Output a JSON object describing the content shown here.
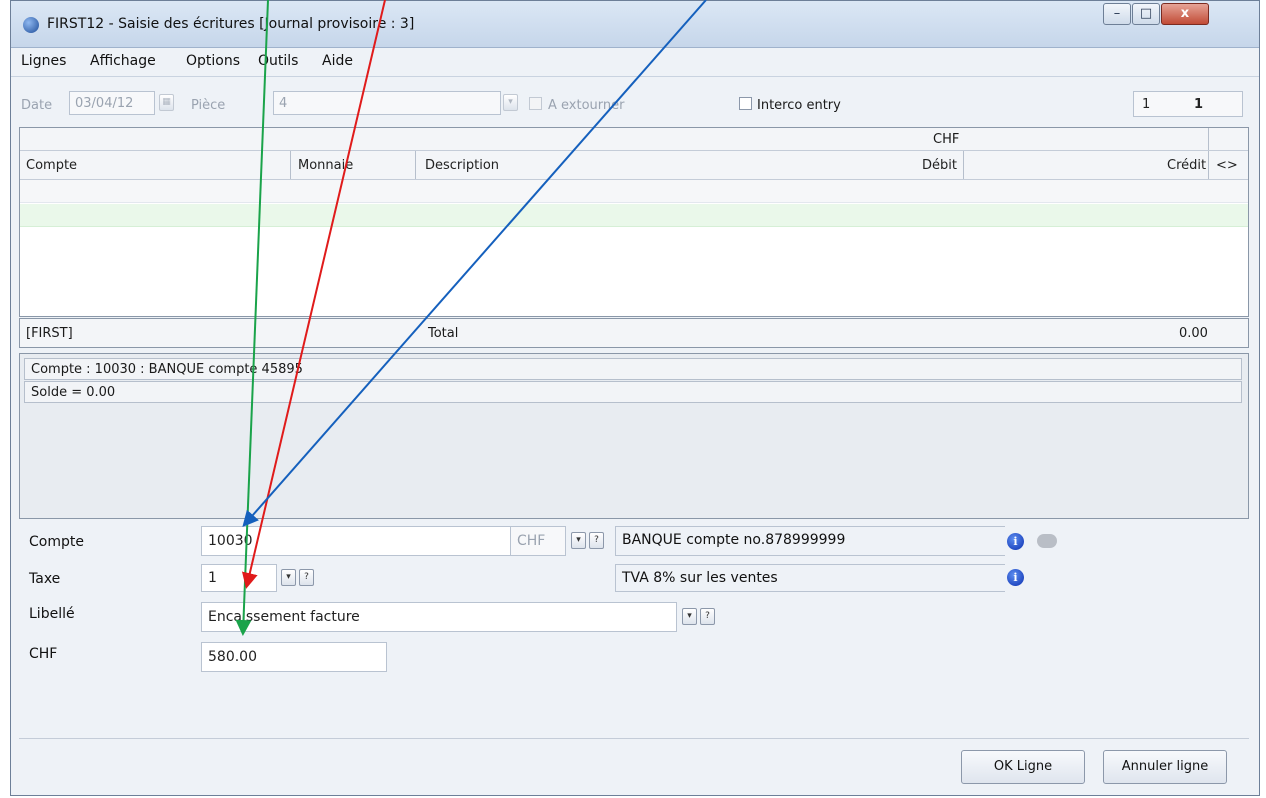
{
  "window": {
    "title": "FIRST12 - Saisie des écritures [Journal provisoire : 3]",
    "controls": {
      "minimize": "–",
      "maximize": "□",
      "close": "x"
    }
  },
  "menu": {
    "items": [
      "Lignes",
      "Affichage",
      "Options",
      "Outils",
      "Aide"
    ]
  },
  "toolbar": {
    "date_label": "Date",
    "date_value": "03/04/12",
    "piece_label": "Pièce",
    "piece_value": "4",
    "extourner_label": "A extourner",
    "interco_label": "Interco entry",
    "counter_left": "1",
    "counter_right": "1"
  },
  "grid": {
    "currency_header": "CHF",
    "columns": [
      "Compte",
      "Monnaie",
      "Description",
      "Débit",
      "Crédit",
      "<>"
    ]
  },
  "total_bar": {
    "left": "[FIRST]",
    "label": "Total",
    "value": "0.00"
  },
  "info": {
    "compte_line": "Compte : 10030 : BANQUE compte 45895",
    "solde_line": "Solde = 0.00"
  },
  "form": {
    "compte": {
      "label": "Compte",
      "value": "10030",
      "currency": "CHF",
      "description": "BANQUE compte no.878999999"
    },
    "taxe": {
      "label": "Taxe",
      "value": "1",
      "description": "TVA 8% sur les ventes"
    },
    "libelle": {
      "label": "Libellé",
      "value": "Encaissement facture"
    },
    "chf": {
      "label": "CHF",
      "value": "580.00"
    },
    "dropdown_glyph": "▾",
    "help_glyph": "?",
    "info_glyph": "i"
  },
  "buttons": {
    "ok": "OK Ligne",
    "cancel": "Annuler ligne"
  },
  "colors": {
    "green_arrow": "#1aa34a",
    "red_arrow": "#e01b1b",
    "blue_arrow": "#1560bd"
  }
}
